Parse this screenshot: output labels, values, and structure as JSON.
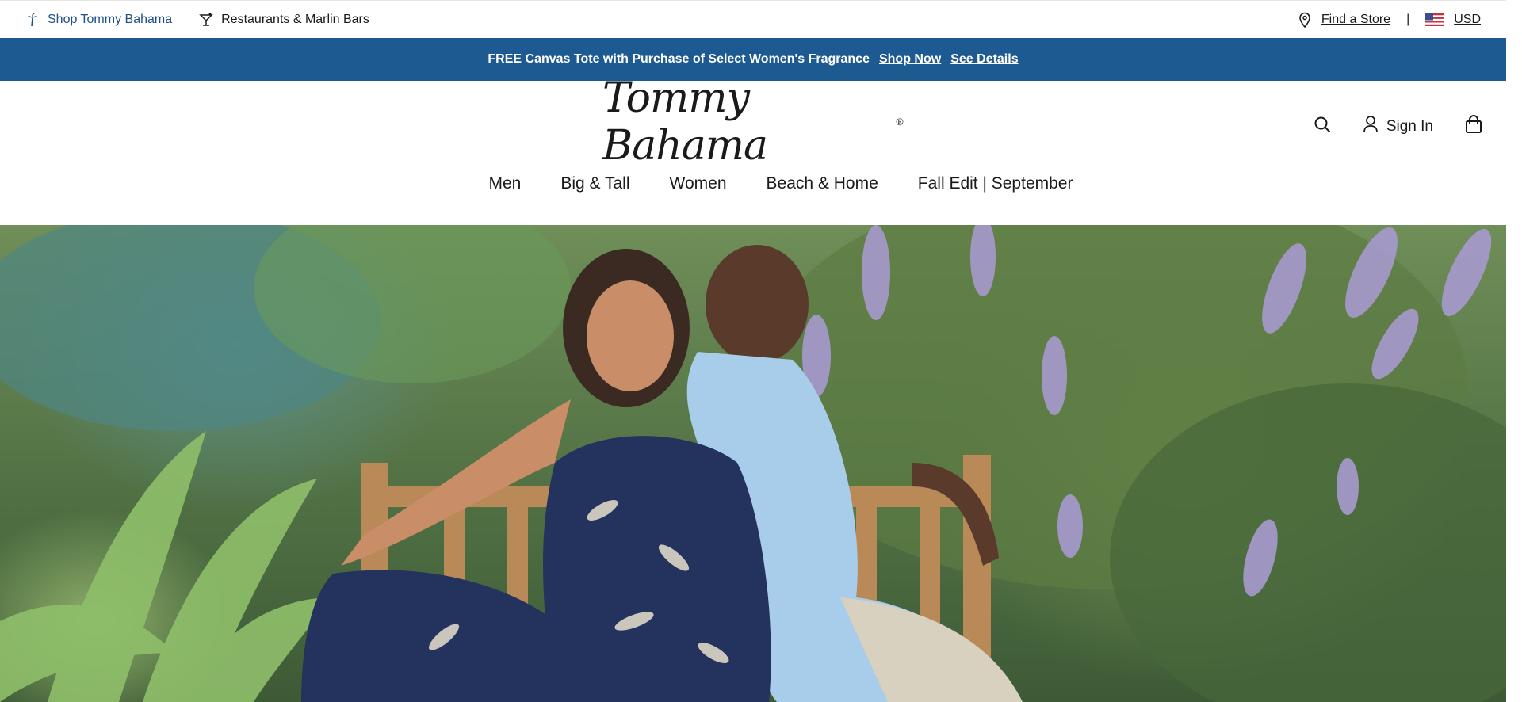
{
  "utility": {
    "shop_label": "Shop Tommy Bahama",
    "restaurants_label": "Restaurants & Marlin Bars",
    "find_store_label": "Find a Store",
    "separator": "|",
    "currency_label": "USD"
  },
  "promo": {
    "text": "FREE Canvas Tote with Purchase of Select Women's Fragrance",
    "shop_now": "Shop Now",
    "see_details": "See Details"
  },
  "header": {
    "logo_text": "Tommy Bahama",
    "logo_mark": "®",
    "sign_in_label": "Sign In"
  },
  "nav": {
    "items": [
      {
        "label": "Men"
      },
      {
        "label": "Big & Tall"
      },
      {
        "label": "Women"
      },
      {
        "label": "Beach & Home"
      },
      {
        "label": "Fall Edit | September"
      }
    ]
  },
  "icons": {
    "palm": "palm-tree-icon",
    "cocktail": "cocktail-icon",
    "location": "location-pin-icon",
    "flag": "us-flag-icon",
    "search": "search-icon",
    "account": "account-icon",
    "bag": "shopping-bag-icon"
  },
  "colors": {
    "promo_bg": "#1e5a92",
    "link_blue": "#1e4f86",
    "text": "#1a1a1a"
  }
}
